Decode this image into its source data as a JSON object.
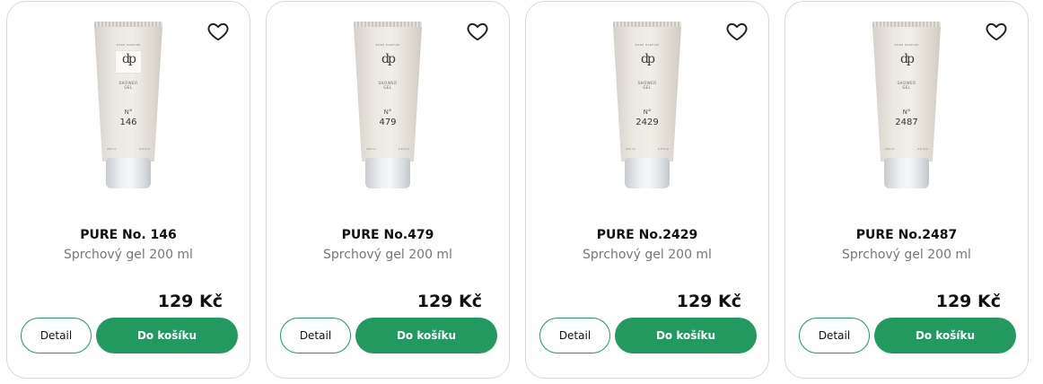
{
  "products": [
    {
      "name": "PURE No. 146",
      "description": "Sprchový gel 200 ml",
      "price": "129 Kč",
      "tube_number": "146",
      "detail_label": "Detail",
      "cart_label": "Do košíku",
      "favorite_icon": "heart-outline-icon"
    },
    {
      "name": "PURE No.479",
      "description": "Sprchový gel 200 ml",
      "price": "129 Kč",
      "tube_number": "479",
      "detail_label": "Detail",
      "cart_label": "Do košíku",
      "favorite_icon": "heart-outline-icon"
    },
    {
      "name": "PURE No.2429",
      "description": "Sprchový gel 200 ml",
      "price": "129 Kč",
      "tube_number": "2429",
      "detail_label": "Detail",
      "cart_label": "Do košíku",
      "favorite_icon": "heart-outline-icon"
    },
    {
      "name": "PURE No.2487",
      "description": "Sprchový gel 200 ml",
      "price": "129 Kč",
      "tube_number": "2487",
      "detail_label": "Detail",
      "cart_label": "Do košíku",
      "favorite_icon": "heart-outline-icon"
    }
  ],
  "tube_text": {
    "logo": "dp",
    "brand": "PURE PARFUM",
    "type_line1": "SHOWER",
    "type_line2": "GEL",
    "number_prefix": "N°",
    "volume_left": "200 ml",
    "volume_right": "6.8 fl.oz"
  },
  "colors": {
    "accent": "#229a5f",
    "card_border": "#d9d9d9",
    "text": "#111111",
    "muted_text": "#777777"
  }
}
